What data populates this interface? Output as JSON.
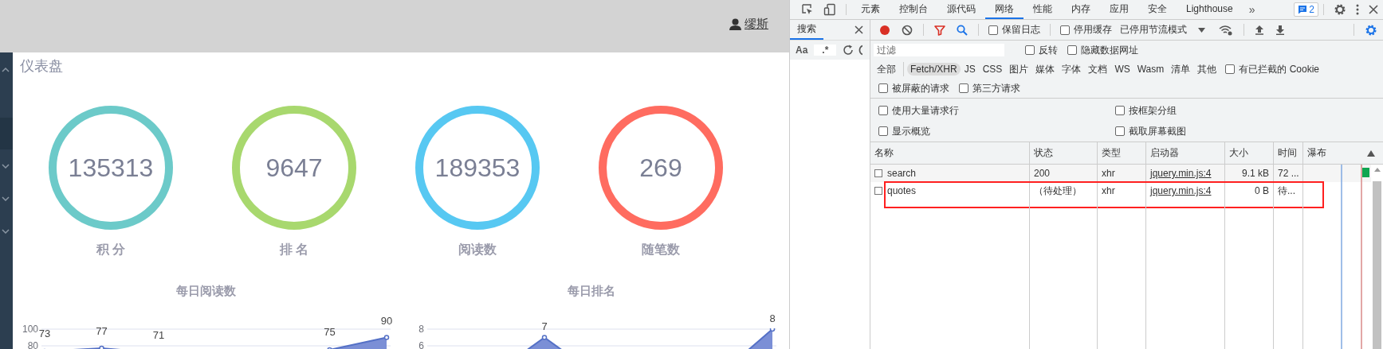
{
  "page": {
    "header": {
      "user": "缪斯"
    },
    "sidebar": {
      "items": [
        {
          "kind": "group",
          "expanded": true,
          "selected": false
        },
        {
          "kind": "link",
          "selected": true
        },
        {
          "kind": "group",
          "expanded": false,
          "selected": false
        },
        {
          "kind": "group",
          "expanded": false,
          "selected": false
        },
        {
          "kind": "group",
          "expanded": false,
          "selected": false
        }
      ]
    },
    "title": "仪表盘",
    "stats": [
      {
        "value": "135313",
        "label": "积 分",
        "color": "#6ccac9"
      },
      {
        "value": "9647",
        "label": "排 名",
        "color": "#a8d86e"
      },
      {
        "value": "189353",
        "label": "阅读数",
        "color": "#57c8f2"
      },
      {
        "value": "269",
        "label": "随笔数",
        "color": "#ff6c60"
      }
    ],
    "charts": [
      {
        "title": "每日阅读数",
        "kind": "picture",
        "axis_labels": [
          "100",
          "80"
        ],
        "point_labels": [
          "73",
          "77",
          "71",
          "75",
          "90"
        ]
      },
      {
        "title": "每日排名",
        "kind": "picture",
        "axis_labels": [
          "8",
          "6"
        ],
        "point_labels": [
          "7",
          "8"
        ]
      }
    ]
  },
  "devtools": {
    "tabs": [
      {
        "label": "元素",
        "selected": false
      },
      {
        "label": "控制台",
        "selected": false
      },
      {
        "label": "源代码",
        "selected": false
      },
      {
        "label": "网络",
        "selected": true
      },
      {
        "label": "性能",
        "selected": false
      },
      {
        "label": "内存",
        "selected": false
      },
      {
        "label": "应用",
        "selected": false
      },
      {
        "label": "安全",
        "selected": false
      },
      {
        "label": "Lighthouse",
        "selected": false
      }
    ],
    "more": "»",
    "issues_badge": "2",
    "search_pane": {
      "tab": "搜索",
      "options": [
        "Aa",
        ".*"
      ]
    },
    "toolbar": {
      "recording": true,
      "filter_active": true,
      "checkboxes": [
        {
          "label": "保留日志",
          "checked": false
        },
        {
          "label": "停用缓存",
          "checked": false
        }
      ],
      "throttling": "已停用节流模式"
    },
    "filter": {
      "placeholder": "过滤",
      "checkboxes": [
        {
          "label": "反转",
          "checked": false
        },
        {
          "label": "隐藏数据网址",
          "checked": false
        }
      ]
    },
    "type_filters": [
      {
        "label": "全部",
        "selected": false
      },
      {
        "label": "Fetch/XHR",
        "selected": true
      },
      {
        "label": "JS",
        "selected": false
      },
      {
        "label": "CSS",
        "selected": false
      },
      {
        "label": "图片",
        "selected": false
      },
      {
        "label": "媒体",
        "selected": false
      },
      {
        "label": "字体",
        "selected": false
      },
      {
        "label": "文档",
        "selected": false
      },
      {
        "label": "WS",
        "selected": false
      },
      {
        "label": "Wasm",
        "selected": false
      },
      {
        "label": "清单",
        "selected": false
      },
      {
        "label": "其他",
        "selected": false
      }
    ],
    "type_checkbox": {
      "label": "有已拦截的 Cookie",
      "checked": false
    },
    "request_checkboxes": [
      {
        "label": "被屏蔽的请求",
        "checked": false
      },
      {
        "label": "第三方请求",
        "checked": false
      }
    ],
    "settings": [
      {
        "label": "使用大量请求行",
        "checked": false
      },
      {
        "label": "按框架分组",
        "checked": false
      },
      {
        "label": "显示概览",
        "checked": false
      },
      {
        "label": "截取屏幕截图",
        "checked": false
      }
    ],
    "table": {
      "columns": [
        "名称",
        "状态",
        "类型",
        "启动器",
        "大小",
        "时间",
        "瀑布"
      ],
      "rows": [
        {
          "name": "search",
          "status": "200",
          "type": "xhr",
          "initiator": "jquery.min.js:4",
          "size": "9.1 kB",
          "time": "72 ...",
          "annotated": false
        },
        {
          "name": "quotes",
          "status": "（待处理）",
          "type": "xhr",
          "initiator": "jquery.min.js:4",
          "size": "0 B",
          "time": "待...",
          "annotated": true
        }
      ]
    }
  }
}
